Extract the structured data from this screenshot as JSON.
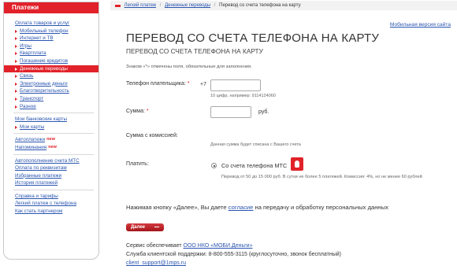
{
  "sidebar": {
    "header": "Платежи",
    "items": [
      {
        "label": "Оплата товаров и услуг",
        "kind": "top"
      },
      {
        "label": "Мобильный телефон",
        "kind": "sub"
      },
      {
        "label": "Интернет и ТВ",
        "kind": "sub"
      },
      {
        "label": "Игры",
        "kind": "sub"
      },
      {
        "label": "Квартплата",
        "kind": "sub"
      },
      {
        "label": "Погашение кредитов",
        "kind": "sub"
      },
      {
        "label": "Денежные переводы",
        "kind": "sub",
        "active": true
      },
      {
        "label": "Связь",
        "kind": "sub"
      },
      {
        "label": "Электронные деньги",
        "kind": "sub"
      },
      {
        "label": "Благотворительность",
        "kind": "sub"
      },
      {
        "label": "Транспорт",
        "kind": "sub"
      },
      {
        "label": "Разное",
        "kind": "sub"
      },
      {
        "kind": "sep"
      },
      {
        "label": "Мои банковские карты",
        "kind": "top"
      },
      {
        "label": "Мои карты",
        "kind": "sub"
      },
      {
        "kind": "sep"
      },
      {
        "label": "Автоплатежи",
        "kind": "top",
        "badge": "new"
      },
      {
        "label": "Напоминания",
        "kind": "top",
        "badge": "new"
      },
      {
        "kind": "sep"
      },
      {
        "label": "Автопополнение счета МТС",
        "kind": "top"
      },
      {
        "label": "Оплата по реквизитам",
        "kind": "top"
      },
      {
        "label": "Избранные платежи",
        "kind": "top"
      },
      {
        "label": "История платежей",
        "kind": "top"
      },
      {
        "kind": "sep"
      },
      {
        "label": "Справка и тарифы",
        "kind": "top"
      },
      {
        "label": "Легкий платеж с телефона",
        "kind": "top"
      },
      {
        "label": "Как стать партнером",
        "kind": "top"
      }
    ]
  },
  "breadcrumb": {
    "home": "Легкий платеж",
    "section": "Денежные переводы",
    "current": "Перевод со счета телефона на карту"
  },
  "mobile_link": "Мобильная версия сайта",
  "page_title": "ПЕРЕВОД СО СЧЕТА ТЕЛЕФОНА НА КАРТУ",
  "page_subtitle": "ПЕРЕВОД СО СЧЕТА ТЕЛЕФОНА НА КАРТУ",
  "required_note": "Знаком «*» отмечены поля, обязательные для заполнения.",
  "form": {
    "phone_label": "Телефон плательщика:",
    "required_mark": "*",
    "phone_prefix": "+7",
    "phone_value": "",
    "phone_hint": "10 цифр, например: 9114124060",
    "amount_label": "Сумма:",
    "amount_value": "",
    "currency": "руб.",
    "commission_label": "Сумма с комиссией:",
    "commission_note": "Данная сумма будет списана с Вашего счета",
    "pay_label": "Платить:",
    "pay_option": "Со счета телефона МТС",
    "pay_desc": "Перевод от 50 до 15 000 руб. В сутки не более 5 платежей. Комиссия: 4%, но не менее 60 рублей"
  },
  "agreement": {
    "before": "Нажимая кнопку «Далее», Вы даете ",
    "link": "согласие",
    "after": " на передачу и обработку персональных данных"
  },
  "next_button": "Далее",
  "service": {
    "line1_prefix": "Сервис обеспечивает ",
    "line1_link": "ООО НКО «МОБИ.Деньги»",
    "line2": "Служба клиентской поддержки: 8-800-555-3115 (круглосуточно, звонок бесплатный)",
    "email": "client_support@1mps.ru"
  },
  "colors": {
    "accent": "#e1222a",
    "link": "#2a55b0"
  }
}
